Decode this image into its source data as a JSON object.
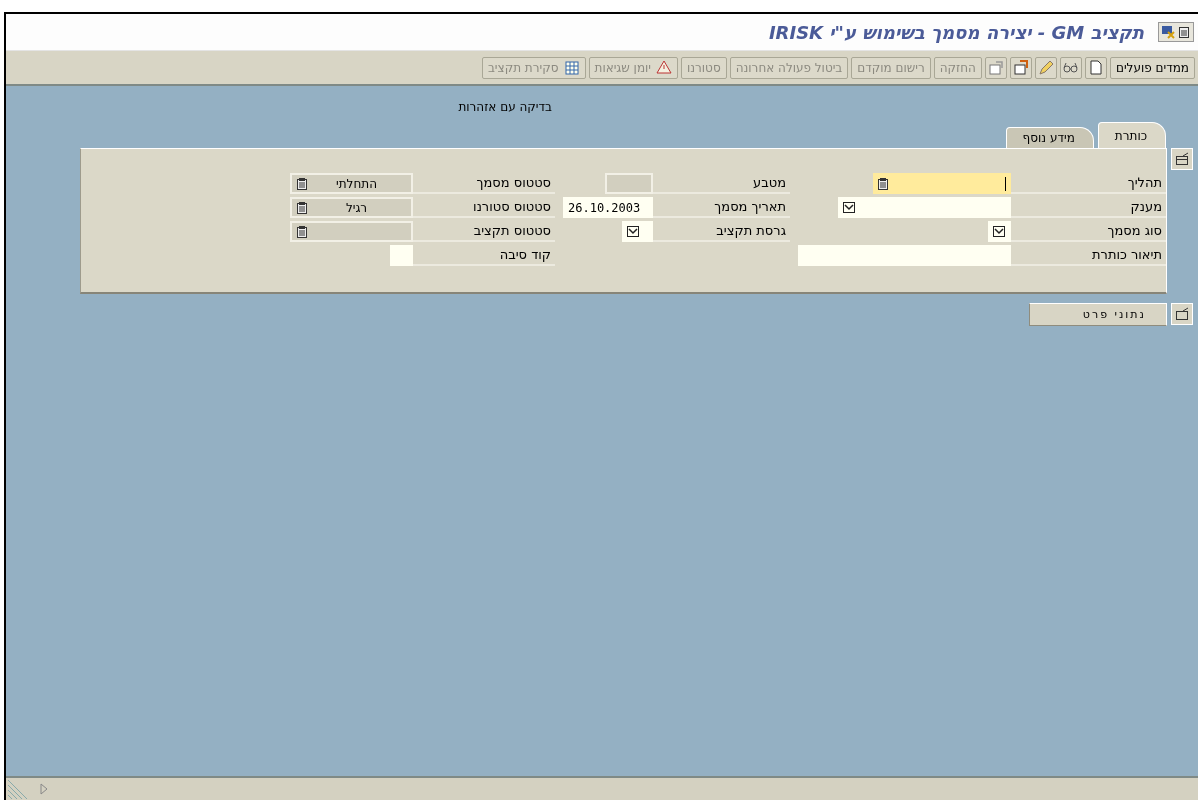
{
  "window": {
    "title": "תקציב GM - יצירה מסמך בשימוש ע\"י IRISK"
  },
  "toolbar": [
    {
      "kind": "text",
      "label": "ממדים פועלים",
      "disabled": false
    },
    {
      "kind": "icon",
      "disabled": false
    },
    {
      "kind": "icon",
      "disabled": false
    },
    {
      "kind": "icon",
      "disabled": false
    },
    {
      "kind": "icon",
      "disabled": false
    },
    {
      "kind": "icon",
      "disabled": false
    },
    {
      "kind": "text",
      "label": "החזקה",
      "disabled": true
    },
    {
      "kind": "text",
      "label": "רישום מוקדם",
      "disabled": true
    },
    {
      "kind": "text",
      "label": "ביטול פעולה אחרונה",
      "disabled": true
    },
    {
      "kind": "text",
      "label": "סטורנו",
      "disabled": true
    },
    {
      "kind": "icon-text",
      "label": "יומן שגיאות",
      "disabled": true
    },
    {
      "kind": "icon-text",
      "label": "סקירת תקציב",
      "disabled": true
    }
  ],
  "message": "בדיקה עם אזהרות",
  "tabs": [
    {
      "label": "כותרת",
      "selected": true
    },
    {
      "label": "מידע נוסף",
      "selected": false
    }
  ],
  "columns": [
    [
      {
        "label": "תהליך",
        "kind": "search",
        "focused": true,
        "disabled": false
      },
      {
        "label": "מענק",
        "kind": "dropdown",
        "focused": false,
        "disabled": false
      },
      {
        "label": "סוג מסמך",
        "kind": "dropdown",
        "focused": false,
        "disabled": false
      },
      {
        "label": "תיאור כותרת",
        "kind": "text",
        "focused": false,
        "disabled": false
      }
    ],
    [
      {
        "label": "מטבע",
        "kind": "text",
        "focused": false,
        "disabled": true
      },
      {
        "label": "תאריך מסמך",
        "kind": "text",
        "value": "26.10.2003",
        "focused": false,
        "disabled": false
      },
      {
        "label": "גרסת תקציב",
        "kind": "dropdown",
        "focused": false,
        "disabled": false
      }
    ],
    [
      {
        "label": "סטטוס מסמך",
        "kind": "search",
        "value": "התחלתי",
        "focused": false,
        "disabled": true
      },
      {
        "label": "סטטוס סטורנו",
        "kind": "search",
        "value": "רגיל",
        "focused": false,
        "disabled": true
      },
      {
        "label": "סטטוס תקציב",
        "kind": "search",
        "focused": false,
        "disabled": true
      },
      {
        "label": "קוד סיבה",
        "kind": "text",
        "focused": false,
        "disabled": false
      }
    ]
  ],
  "detail_button": {
    "label": "נתוני פרט"
  }
}
